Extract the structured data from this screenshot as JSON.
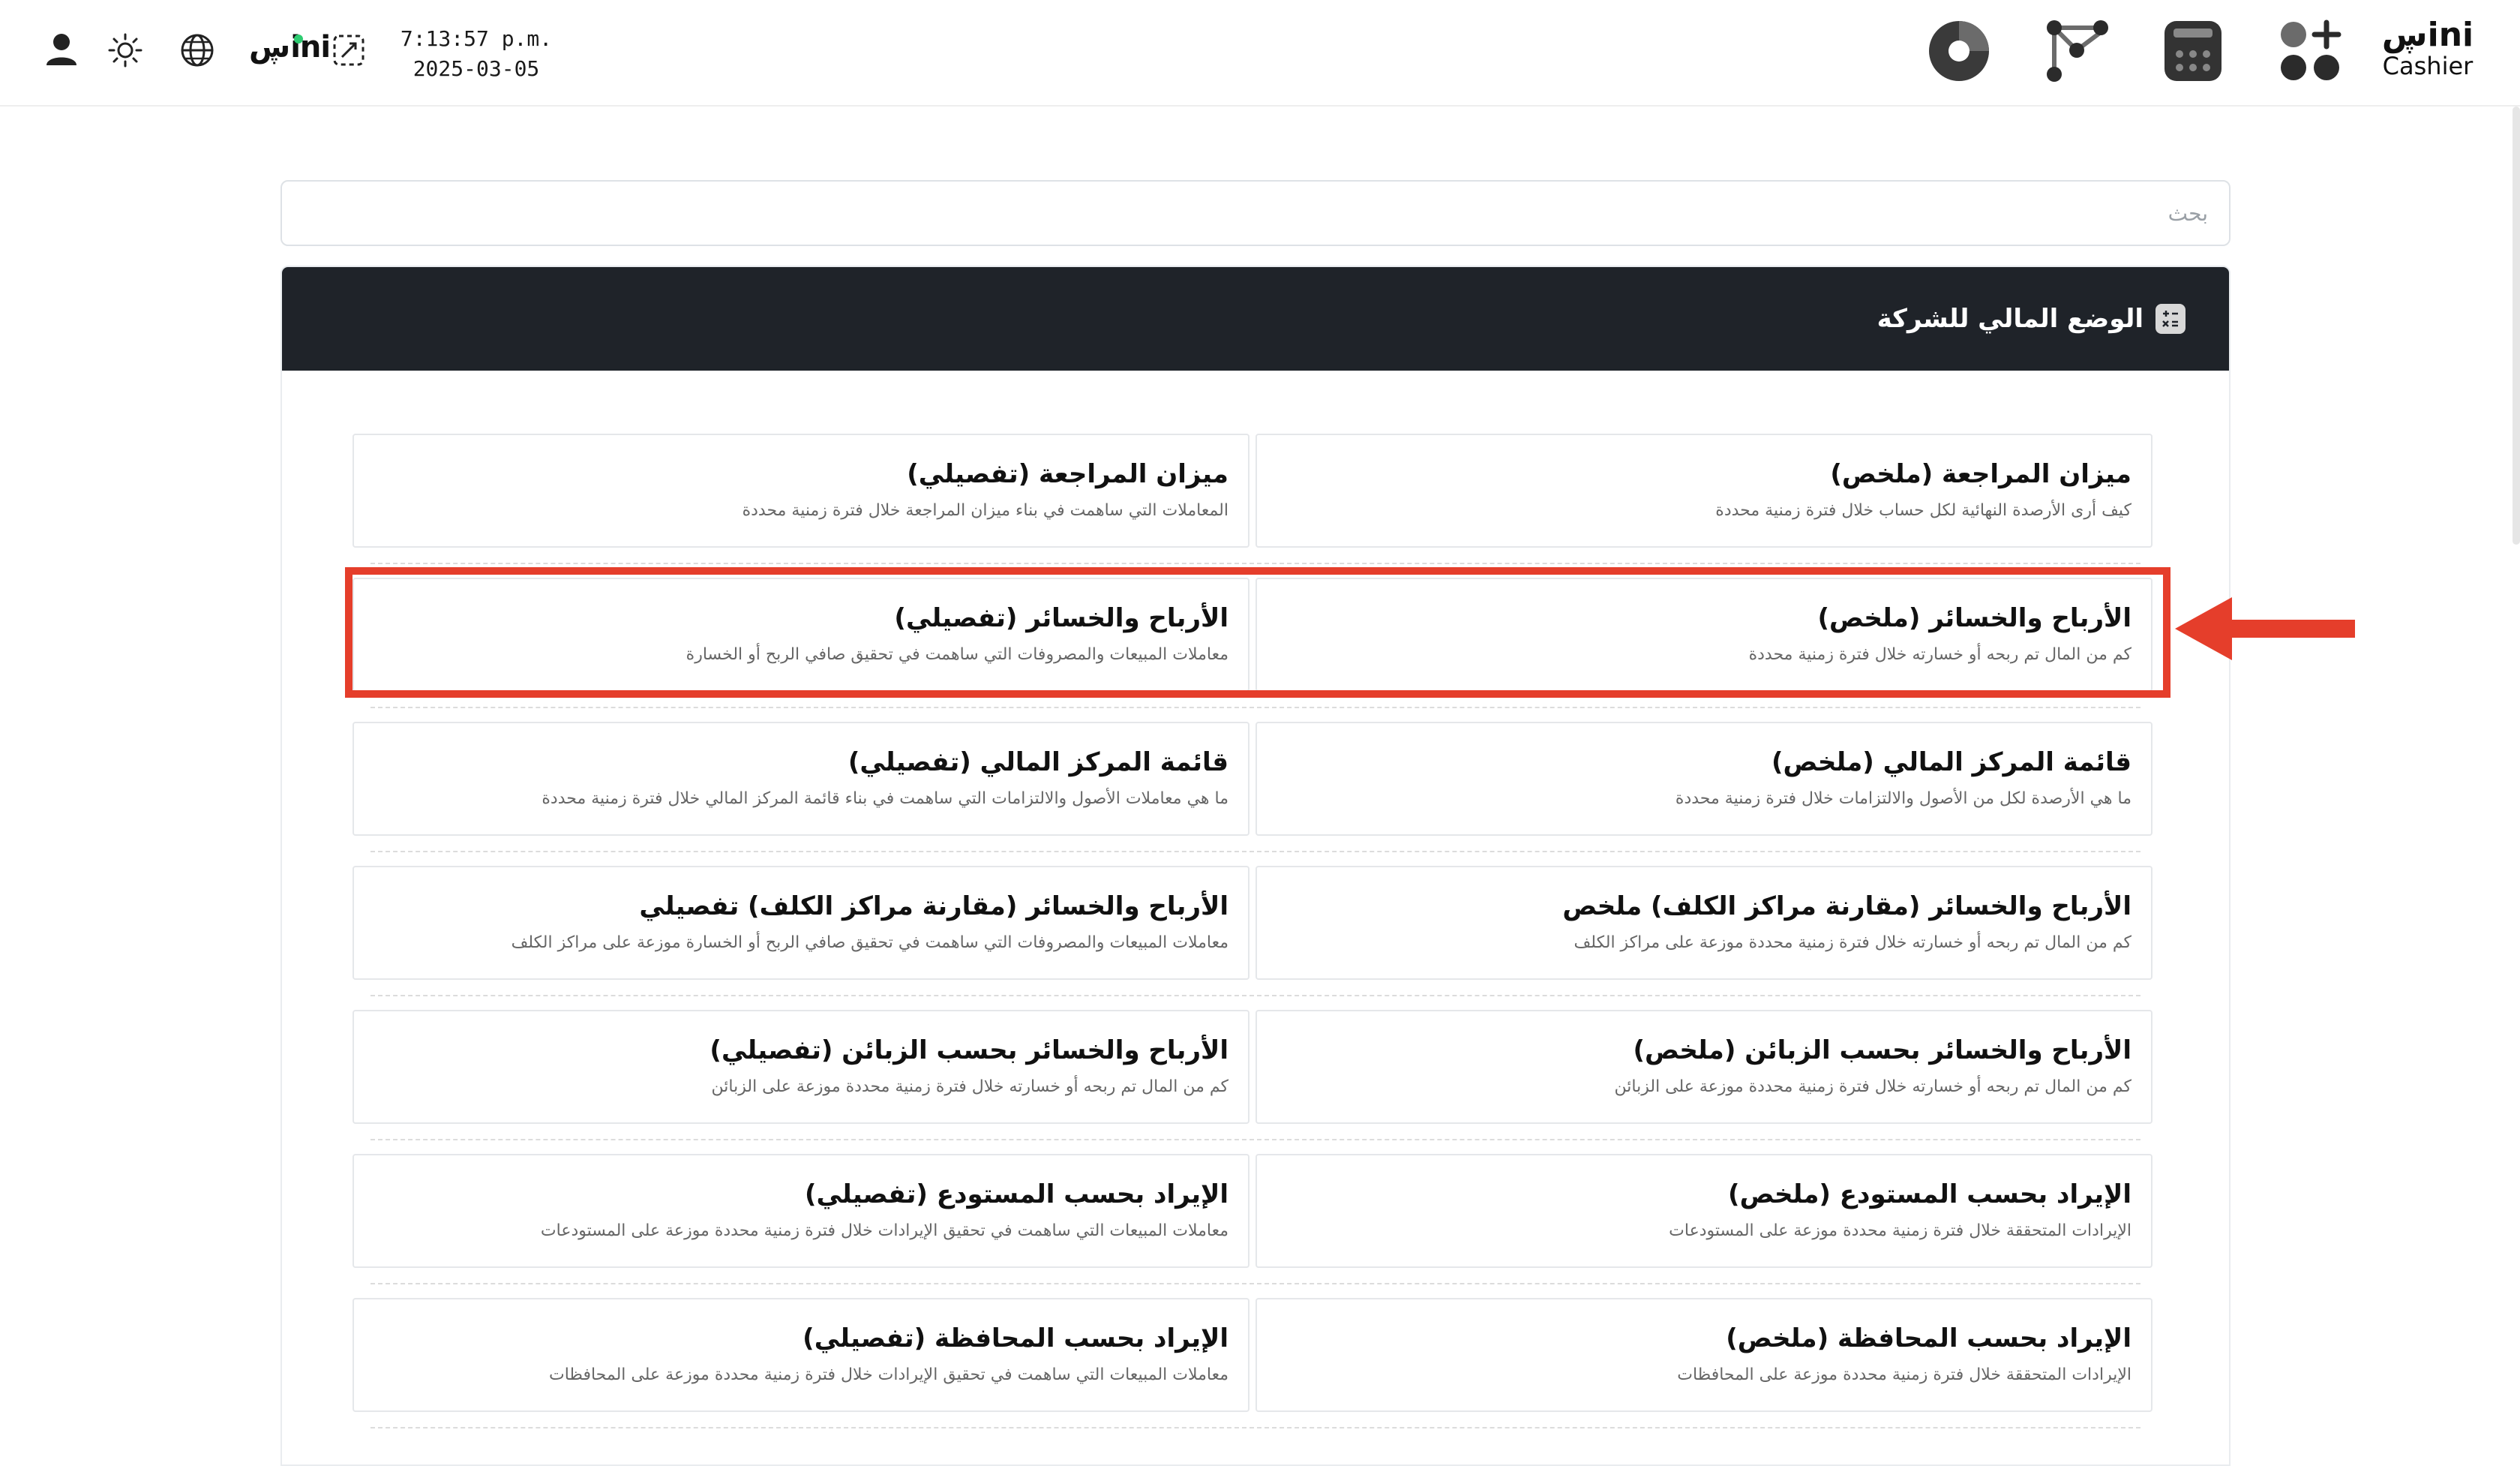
{
  "topbar": {
    "clock_time": "7:13:57 p.m.",
    "clock_date": "2025-03-05",
    "sini_small": "ڛini",
    "brand_top": "ڛini",
    "brand_bottom": "Cashier",
    "status_dot_color": "#2ecc71",
    "left_icons": [
      "user-icon",
      "brightness-icon",
      "globe-icon",
      "sini-logo",
      "crop-icon"
    ],
    "right_icons": [
      "pie-chart-icon",
      "network-icon",
      "calculator-icon",
      "apps-add-icon",
      "brand-logo"
    ]
  },
  "search": {
    "placeholder": "بحث",
    "value": ""
  },
  "card": {
    "title": "الوضع المالي للشركة",
    "header_color": "#1f2329",
    "icon": "calculator-icon"
  },
  "rows": [
    {
      "right": {
        "title": "ميزان المراجعة (ملخص)",
        "desc": "كيف أرى الأرصدة النهائية لكل حساب خلال فترة زمنية محددة"
      },
      "left": {
        "title": "ميزان المراجعة (تفصيلي)",
        "desc": "المعاملات التي ساهمت في بناء ميزان المراجعة خلال فترة زمنية محددة"
      }
    },
    {
      "right": {
        "title": "الأرباح والخسائر (ملخص)",
        "desc": "كم من المال تم ربحه أو خسارته خلال فترة زمنية محددة"
      },
      "left": {
        "title": "الأرباح والخسائر (تفصيلي)",
        "desc": "معاملات المبيعات والمصروفات التي ساهمت في تحقيق صافي الربح أو الخسارة"
      }
    },
    {
      "right": {
        "title": "قائمة المركز المالي (ملخص)",
        "desc": "ما هي الأرصدة لكل من الأصول والالتزامات خلال فترة زمنية محددة"
      },
      "left": {
        "title": "قائمة المركز المالي (تفصيلي)",
        "desc": "ما هي معاملات الأصول والالتزامات التي ساهمت في بناء قائمة المركز المالي خلال فترة زمنية محددة"
      }
    },
    {
      "right": {
        "title": "الأرباح والخسائر (مقارنة مراكز الكلف) ملخص",
        "desc": "كم من المال تم ربحه أو خسارته خلال فترة زمنية محددة موزعة على مراكز الكلف"
      },
      "left": {
        "title": "الأرباح والخسائر (مقارنة مراكز الكلف) تفصيلي",
        "desc": "معاملات المبيعات والمصروفات التي ساهمت في تحقيق صافي الربح أو الخسارة موزعة على مراكز الكلف"
      }
    },
    {
      "right": {
        "title": "الأرباح والخسائر بحسب الزبائن (ملخص)",
        "desc": "كم من المال تم ربحه أو خسارته خلال فترة زمنية محددة موزعة على الزبائن"
      },
      "left": {
        "title": "الأرباح والخسائر بحسب الزبائن (تفصيلي)",
        "desc": "كم من المال تم ربحه أو خسارته خلال فترة زمنية محددة موزعة على الزبائن"
      }
    },
    {
      "right": {
        "title": "الإيراد بحسب المستودع (ملخص)",
        "desc": "الإيرادات المتحققة خلال فترة زمنية محددة موزعة على المستودعات"
      },
      "left": {
        "title": "الإيراد بحسب المستودع (تفصيلي)",
        "desc": "معاملات المبيعات التي ساهمت في تحقيق الإيرادات خلال فترة زمنية محددة موزعة على المستودعات"
      }
    },
    {
      "right": {
        "title": "الإيراد بحسب المحافظة (ملخص)",
        "desc": "الإيرادات المتحققة خلال فترة زمنية محددة موزعة على المحافظات"
      },
      "left": {
        "title": "الإيراد بحسب المحافظة (تفصيلي)",
        "desc": "معاملات المبيعات التي ساهمت في تحقيق الإيرادات خلال فترة زمنية محددة موزعة على المحافظات"
      }
    }
  ],
  "annotation": {
    "highlight_color": "#e53e2b",
    "highlighted_row": 1,
    "arrow": "arrow-left-icon"
  }
}
